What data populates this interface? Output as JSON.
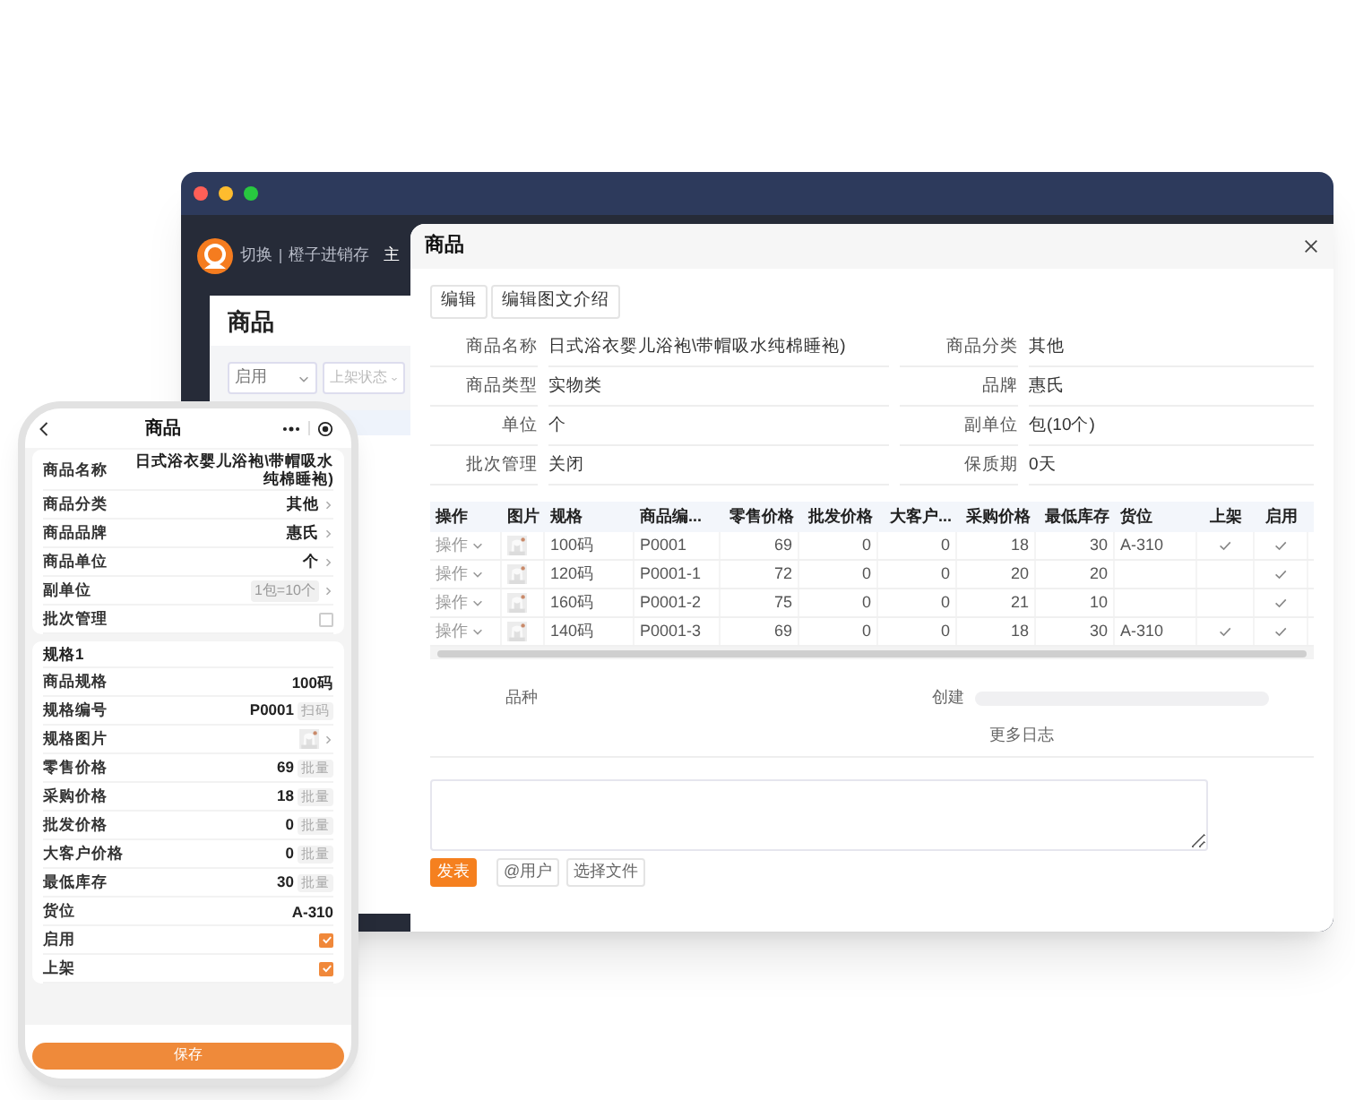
{
  "desktop": {
    "header": {
      "switch_label": "切换",
      "app_name": "橙子进销存",
      "nav_item": "主"
    },
    "page": {
      "title": "商品",
      "filters": [
        {
          "value": "启用"
        },
        {
          "placeholder": "上架状态"
        }
      ]
    },
    "modal": {
      "title": "商品",
      "buttons": [
        "编辑",
        "编辑图文介绍"
      ],
      "fields": [
        {
          "label": "商品名称",
          "value": "日式浴衣婴儿浴袍\\带帽吸水纯棉睡袍)"
        },
        {
          "label": "商品分类",
          "value": "其他"
        },
        {
          "label": "商品类型",
          "value": "实物类"
        },
        {
          "label": "品牌",
          "value": "惠氏"
        },
        {
          "label": "单位",
          "value": "个"
        },
        {
          "label": "副单位",
          "value": "包(10个)"
        },
        {
          "label": "批次管理",
          "value": "关闭"
        },
        {
          "label": "保质期",
          "value": "0天"
        }
      ],
      "table": {
        "columns": [
          {
            "label": "操作",
            "kind": "action"
          },
          {
            "label": "图片",
            "kind": "picture"
          },
          {
            "label": "规格",
            "kind": "text"
          },
          {
            "label": "商品编...",
            "kind": "text"
          },
          {
            "label": "零售价格",
            "kind": "number"
          },
          {
            "label": "批发价格",
            "kind": "number"
          },
          {
            "label": "大客户...",
            "kind": "number"
          },
          {
            "label": "采购价格",
            "kind": "number"
          },
          {
            "label": "最低库存",
            "kind": "number"
          },
          {
            "label": "货位",
            "kind": "text"
          },
          {
            "label": "上架",
            "kind": "listed"
          },
          {
            "label": "启用",
            "kind": "enabled"
          }
        ],
        "rows": [
          {
            "cells": [
              "操作",
              "",
              "100码",
              "P0001",
              "69",
              "0",
              "0",
              "18",
              "30",
              "A-310"
            ],
            "listed": true,
            "enabled": true
          },
          {
            "cells": [
              "操作",
              "",
              "120码",
              "P0001-1",
              "72",
              "0",
              "0",
              "20",
              "20",
              ""
            ],
            "listed": false,
            "enabled": true
          },
          {
            "cells": [
              "操作",
              "",
              "160码",
              "P0001-2",
              "75",
              "0",
              "0",
              "21",
              "10",
              ""
            ],
            "listed": false,
            "enabled": true
          },
          {
            "cells": [
              "操作",
              "",
              "140码",
              "P0001-3",
              "69",
              "0",
              "0",
              "18",
              "30",
              "A-310"
            ],
            "listed": true,
            "enabled": true
          }
        ]
      },
      "variety_label": "品种",
      "created_label": "创建",
      "more_log": "更多日志",
      "actions": [
        {
          "label": "发表",
          "kind": "primary"
        },
        {
          "label": "@用户",
          "kind": "plain"
        },
        {
          "label": "选择文件",
          "kind": "plain"
        }
      ]
    }
  },
  "phone": {
    "title": "商品",
    "groups": [
      {
        "rows": [
          {
            "kind": "text",
            "label": "商品名称",
            "value": "日式浴衣婴儿浴袍\\带帽吸水纯棉睡袍)"
          },
          {
            "kind": "select",
            "label": "商品分类",
            "value": "其他"
          },
          {
            "kind": "select",
            "label": "商品品牌",
            "value": "惠氏"
          },
          {
            "kind": "select",
            "label": "商品单位",
            "value": "个"
          },
          {
            "kind": "chip_select",
            "label": "副单位",
            "value": "1包=10个"
          },
          {
            "kind": "checkbox",
            "label": "批次管理",
            "checked": false
          }
        ]
      },
      {
        "title": "规格1",
        "rows": [
          {
            "kind": "text",
            "label": "商品规格",
            "value": "100码"
          },
          {
            "kind": "action",
            "label": "规格编号",
            "value": "P0001",
            "button": "扫码"
          },
          {
            "label": "规格图片"
          },
          {
            "kind": "action",
            "label": "零售价格",
            "value": "69",
            "button": "批量"
          },
          {
            "kind": "action",
            "label": "采购价格",
            "value": "18",
            "button": "批量"
          },
          {
            "kind": "action",
            "label": "批发价格",
            "value": "0",
            "button": "批量"
          },
          {
            "kind": "action",
            "label": "大客户价格",
            "value": "0",
            "button": "批量"
          },
          {
            "kind": "action",
            "label": "最低库存",
            "value": "30",
            "button": "批量"
          },
          {
            "kind": "text",
            "label": "货位",
            "value": "A-310"
          },
          {
            "kind": "checkbox",
            "label": "启用",
            "checked": true
          },
          {
            "kind": "checkbox",
            "label": "上架",
            "checked": true
          }
        ]
      }
    ],
    "save": "保存"
  }
}
